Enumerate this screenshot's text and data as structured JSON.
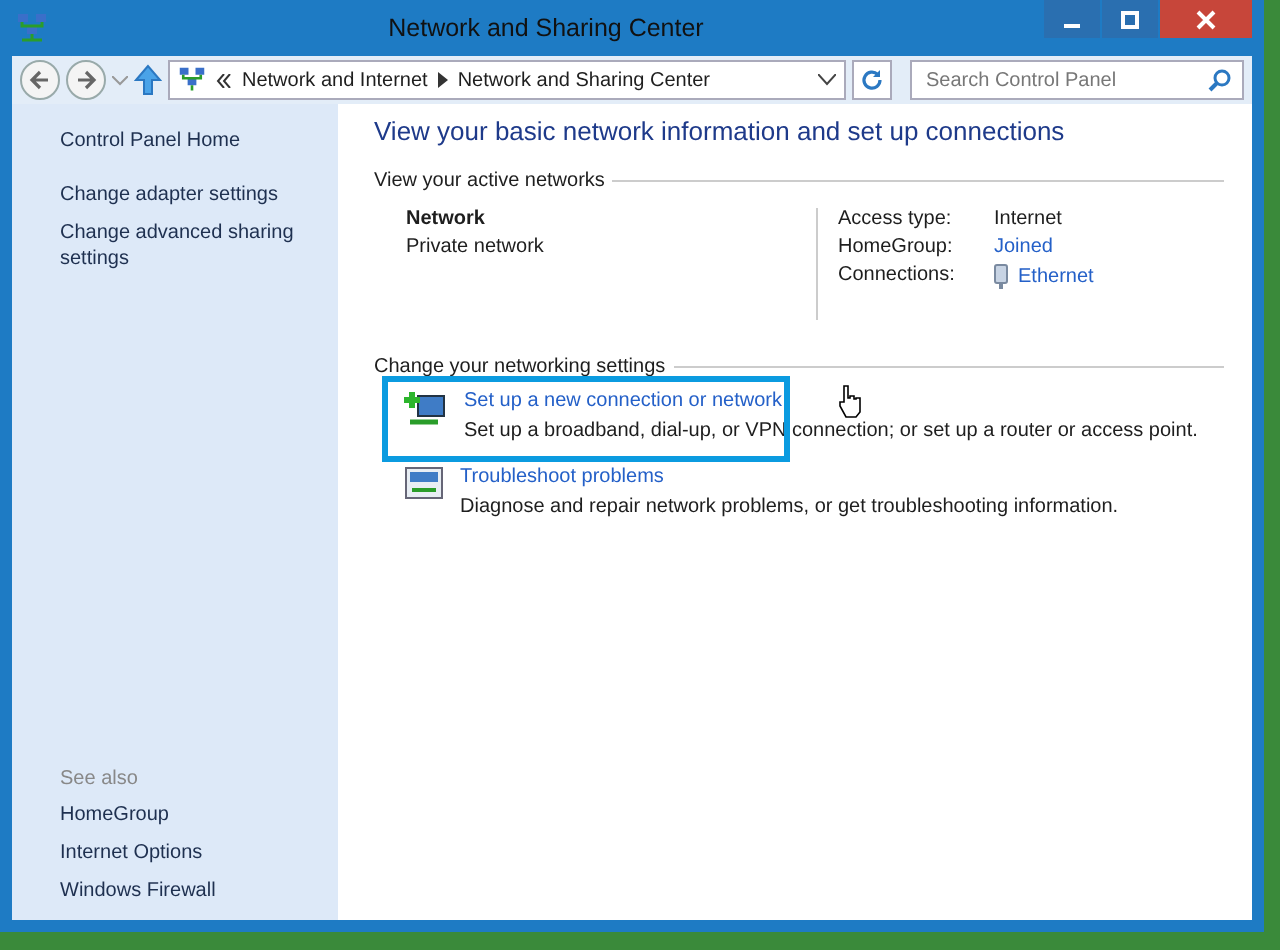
{
  "window": {
    "title": "Network and Sharing Center"
  },
  "address_bar": {
    "crumbs": [
      "Network and Internet",
      "Network and Sharing Center"
    ]
  },
  "search": {
    "placeholder": "Search Control Panel"
  },
  "sidebar": {
    "items": [
      {
        "label": "Control Panel Home"
      },
      {
        "label": "Change adapter settings"
      },
      {
        "label": "Change advanced sharing settings"
      }
    ],
    "see_also": {
      "heading": "See also",
      "items": [
        "HomeGroup",
        "Internet Options",
        "Windows Firewall"
      ]
    }
  },
  "main": {
    "heading": "View your basic network information and set up connections",
    "active_networks": {
      "heading": "View your active networks",
      "name": "Network",
      "category": "Private network",
      "details": [
        {
          "label": "Access type:",
          "value": "Internet",
          "kind": "text"
        },
        {
          "label": "HomeGroup:",
          "value": "Joined",
          "kind": "link"
        },
        {
          "label": "Connections:",
          "value": "Ethernet",
          "kind": "connection"
        }
      ]
    },
    "settings": {
      "heading": "Change your networking settings",
      "tasks": [
        {
          "link": "Set up a new connection or network",
          "description": "Set up a broadband, dial-up, or VPN connection; or set up a router or access point.",
          "highlighted": true,
          "kind": "new-connection"
        },
        {
          "link": "Troubleshoot problems",
          "description": "Diagnose and repair network problems, or get troubleshooting information.",
          "highlighted": false,
          "kind": "troubleshoot"
        }
      ]
    }
  }
}
